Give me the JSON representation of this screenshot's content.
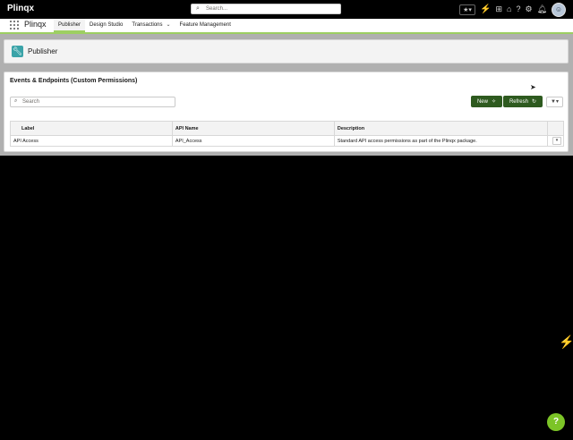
{
  "header": {
    "app_title": "Plinqx",
    "search_placeholder": "Search...",
    "icons": [
      "favorites-icon",
      "lightning-icon",
      "add-icon",
      "trailhead-icon",
      "help-icon",
      "setup-gear-icon",
      "notifications-bell-icon",
      "user-avatar"
    ]
  },
  "nav": {
    "app_name": "Plinqx",
    "tabs": [
      {
        "label": "Publisher",
        "active": true
      },
      {
        "label": "Design Studio"
      },
      {
        "label": "Transactions",
        "has_dropdown": true
      },
      {
        "label": "Feature Management"
      }
    ]
  },
  "page": {
    "icon": "wrench-icon",
    "title": "Publisher"
  },
  "card": {
    "title": "Events & Endpoints (Custom Permissions)",
    "search_placeholder": "Search",
    "new_label": "New",
    "refresh_label": "Refresh",
    "filter_icon": "filter-icon"
  },
  "table": {
    "columns": [
      "Label",
      "API Name",
      "Description"
    ],
    "rows": [
      {
        "label": "API Access",
        "api_name": "API_Access",
        "description": "Standard API access permissions as part of the Plinqx package."
      }
    ]
  },
  "colors": {
    "accent_green": "#2e5a1f",
    "nav_underline": "#9dcf62",
    "help_button": "#7cc427",
    "page_icon_bg": "#3aa3a8"
  }
}
